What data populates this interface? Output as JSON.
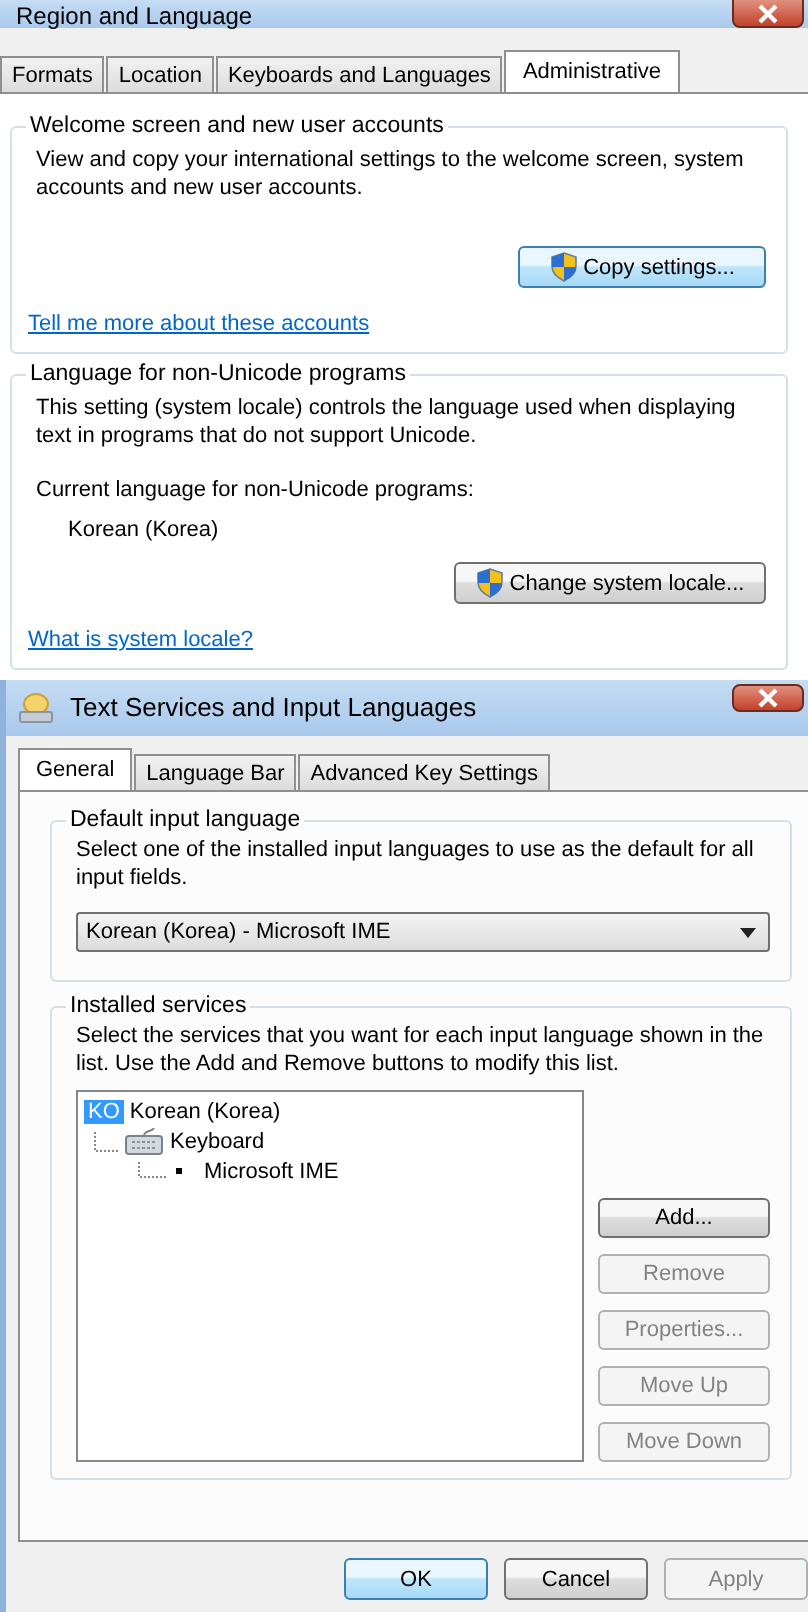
{
  "region_window": {
    "title": "Region and Language",
    "tabs": [
      {
        "label": "Formats",
        "selected": false
      },
      {
        "label": "Location",
        "selected": false
      },
      {
        "label": "Keyboards and Languages",
        "selected": false
      },
      {
        "label": "Administrative",
        "selected": true
      }
    ],
    "welcome_group": {
      "title": "Welcome screen and new user accounts",
      "description": "View and copy your international settings to the welcome screen, system accounts and new user accounts.",
      "button": "Copy settings...",
      "link": "Tell me more about these accounts"
    },
    "locale_group": {
      "title": "Language for non-Unicode programs",
      "description": "This setting (system locale) controls the language used when displaying text in programs that do not support Unicode.",
      "current_label": "Current language for non-Unicode programs:",
      "current_value": "Korean (Korea)",
      "button": "Change system locale...",
      "link": "What is system locale?"
    }
  },
  "text_services_window": {
    "title": "Text Services and Input Languages",
    "tabs": [
      {
        "label": "General",
        "selected": true
      },
      {
        "label": "Language Bar",
        "selected": false
      },
      {
        "label": "Advanced Key Settings",
        "selected": false
      }
    ],
    "default_group": {
      "title": "Default input language",
      "description": "Select one of the installed input languages to use as the default for all input fields.",
      "dropdown_value": "Korean (Korea) - Microsoft IME"
    },
    "installed_group": {
      "title": "Installed services",
      "description": "Select the services that you want for each input language shown in the list. Use the Add and Remove buttons to modify this list.",
      "tree": [
        {
          "badge": "KO",
          "label": "Korean (Korea)",
          "selected": true,
          "children": [
            {
              "label": "Keyboard",
              "selected": false,
              "children": [
                {
                  "label": "Microsoft IME",
                  "selected": false
                }
              ]
            }
          ]
        }
      ],
      "buttons": [
        {
          "label": "Add...",
          "disabled": false
        },
        {
          "label": "Remove",
          "disabled": true
        },
        {
          "label": "Properties...",
          "disabled": true
        },
        {
          "label": "Move Up",
          "disabled": true
        },
        {
          "label": "Move Down",
          "disabled": true
        }
      ]
    },
    "footer_buttons": [
      {
        "label": "OK",
        "disabled": false,
        "default": true
      },
      {
        "label": "Cancel",
        "disabled": false,
        "default": false
      },
      {
        "label": "Apply",
        "disabled": true,
        "default": false
      }
    ]
  }
}
